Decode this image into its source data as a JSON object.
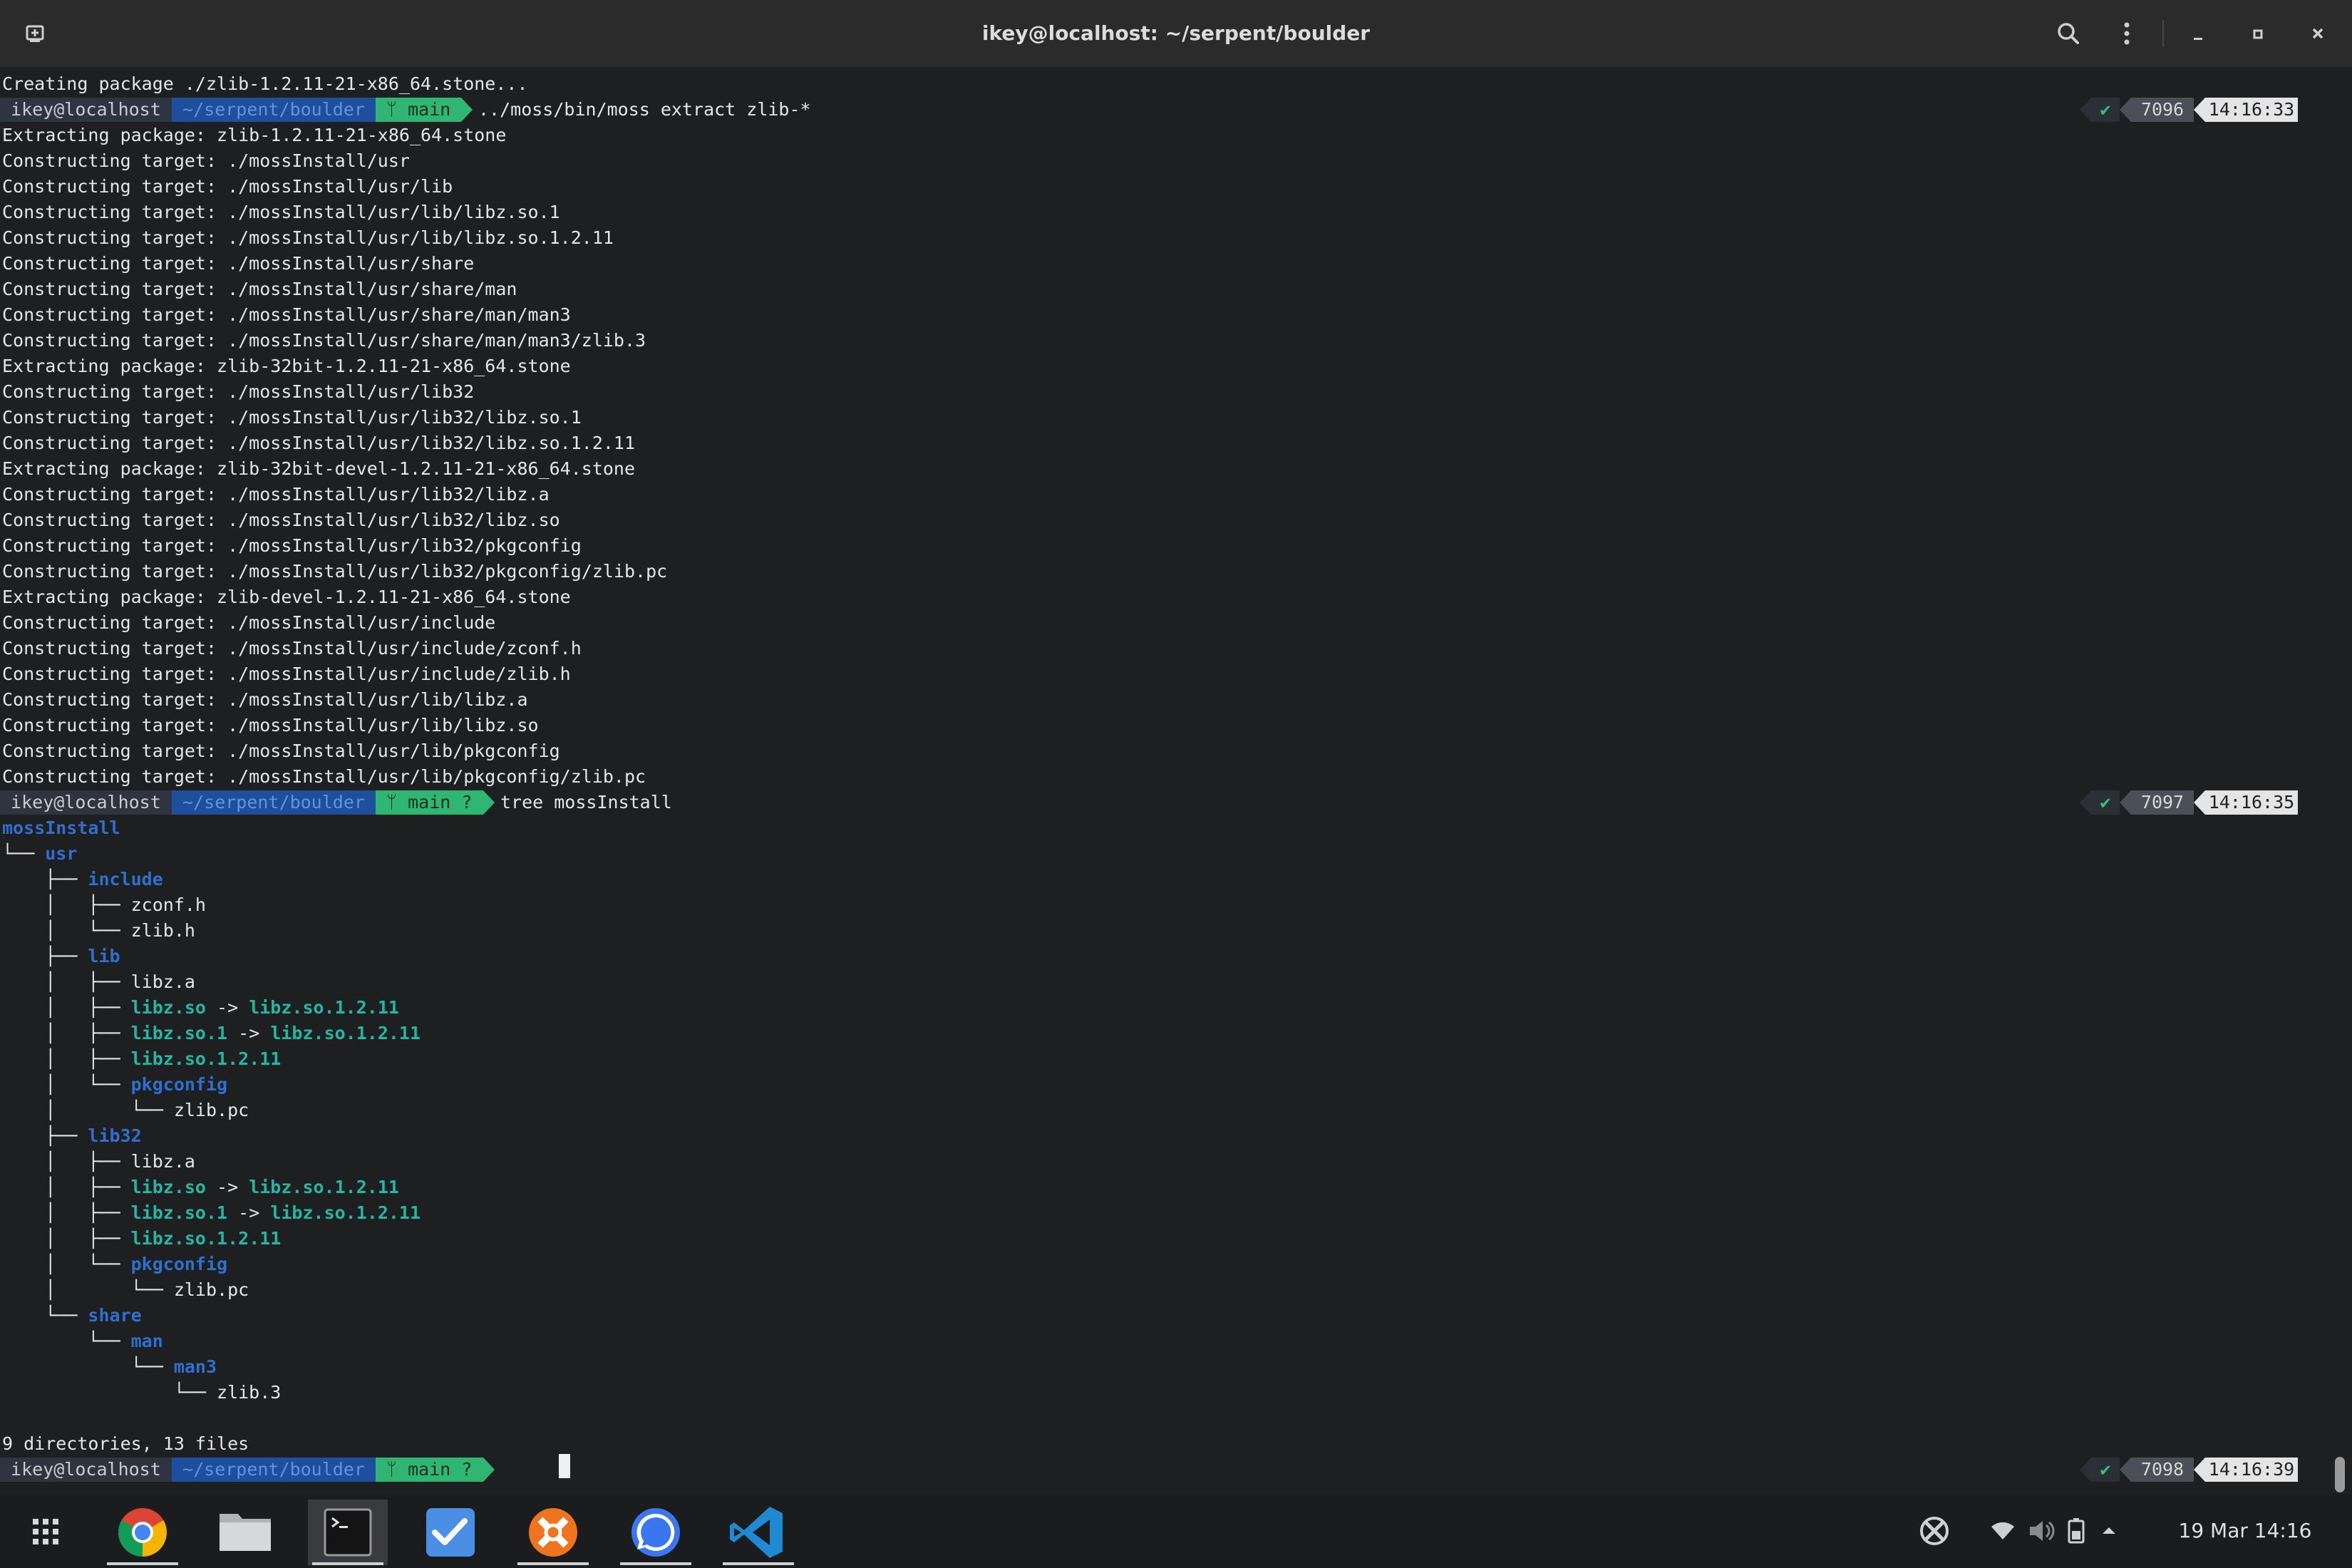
{
  "window": {
    "title": "ikey@localhost: ~/serpent/boulder"
  },
  "toolbar": {
    "new_tab_icon": "new-tab-icon",
    "search_icon": "search-icon",
    "menu_icon": "kebab-menu-icon",
    "minimize_icon": "minimize-icon",
    "maximize_icon": "maximize-icon",
    "close_icon": "close-icon"
  },
  "colors": {
    "background": "#1d1f21",
    "prompt_user_bg": "#2e3440",
    "prompt_path_bg": "#1d4f9c",
    "prompt_git_bg": "#2fb673",
    "directory": "#2f6fcf",
    "symlink": "#23b7a6"
  },
  "terminal": {
    "line1": "Creating package ./zlib-1.2.11-21-x86_64.stone...",
    "prompts": [
      {
        "user": " ikey@localhost ",
        "path": " ~/serpent/boulder ",
        "git": " ᛘ main ",
        "command": "../moss/bin/moss extract zlib-*",
        "status": "✔",
        "count": "7096",
        "time": "14:16:33"
      },
      {
        "user": " ikey@localhost ",
        "path": " ~/serpent/boulder ",
        "git": " ᛘ main ? ",
        "command": "tree mossInstall",
        "status": "✔",
        "count": "7097",
        "time": "14:16:35"
      },
      {
        "user": " ikey@localhost ",
        "path": " ~/serpent/boulder ",
        "git": " ᛘ main ? ",
        "command": "",
        "status": "✔",
        "count": "7098",
        "time": "14:16:39"
      }
    ],
    "extract_output": [
      "Extracting package: zlib-1.2.11-21-x86_64.stone",
      "Constructing target: ./mossInstall/usr",
      "Constructing target: ./mossInstall/usr/lib",
      "Constructing target: ./mossInstall/usr/lib/libz.so.1",
      "Constructing target: ./mossInstall/usr/lib/libz.so.1.2.11",
      "Constructing target: ./mossInstall/usr/share",
      "Constructing target: ./mossInstall/usr/share/man",
      "Constructing target: ./mossInstall/usr/share/man/man3",
      "Constructing target: ./mossInstall/usr/share/man/man3/zlib.3",
      "Extracting package: zlib-32bit-1.2.11-21-x86_64.stone",
      "Constructing target: ./mossInstall/usr/lib32",
      "Constructing target: ./mossInstall/usr/lib32/libz.so.1",
      "Constructing target: ./mossInstall/usr/lib32/libz.so.1.2.11",
      "Extracting package: zlib-32bit-devel-1.2.11-21-x86_64.stone",
      "Constructing target: ./mossInstall/usr/lib32/libz.a",
      "Constructing target: ./mossInstall/usr/lib32/libz.so",
      "Constructing target: ./mossInstall/usr/lib32/pkgconfig",
      "Constructing target: ./mossInstall/usr/lib32/pkgconfig/zlib.pc",
      "Extracting package: zlib-devel-1.2.11-21-x86_64.stone",
      "Constructing target: ./mossInstall/usr/include",
      "Constructing target: ./mossInstall/usr/include/zconf.h",
      "Constructing target: ./mossInstall/usr/include/zlib.h",
      "Constructing target: ./mossInstall/usr/lib/libz.a",
      "Constructing target: ./mossInstall/usr/lib/libz.so",
      "Constructing target: ./mossInstall/usr/lib/pkgconfig",
      "Constructing target: ./mossInstall/usr/lib/pkgconfig/zlib.pc"
    ],
    "tree_lines": [
      [
        {
          "t": "mossInstall",
          "c": "dir"
        }
      ],
      [
        {
          "t": "└── "
        },
        {
          "t": "usr",
          "c": "dir"
        }
      ],
      [
        {
          "t": "    ├── "
        },
        {
          "t": "include",
          "c": "dir"
        }
      ],
      [
        {
          "t": "    │   ├── zconf.h"
        }
      ],
      [
        {
          "t": "    │   └── zlib.h"
        }
      ],
      [
        {
          "t": "    ├── "
        },
        {
          "t": "lib",
          "c": "dir"
        }
      ],
      [
        {
          "t": "    │   ├── libz.a"
        }
      ],
      [
        {
          "t": "    │   ├── "
        },
        {
          "t": "libz.so",
          "c": "lnk"
        },
        {
          "t": " -> "
        },
        {
          "t": "libz.so.1.2.11",
          "c": "lnk"
        }
      ],
      [
        {
          "t": "    │   ├── "
        },
        {
          "t": "libz.so.1",
          "c": "lnk"
        },
        {
          "t": " -> "
        },
        {
          "t": "libz.so.1.2.11",
          "c": "lnk"
        }
      ],
      [
        {
          "t": "    │   ├── "
        },
        {
          "t": "libz.so.1.2.11",
          "c": "lnk"
        }
      ],
      [
        {
          "t": "    │   └── "
        },
        {
          "t": "pkgconfig",
          "c": "dir"
        }
      ],
      [
        {
          "t": "    │       └── zlib.pc"
        }
      ],
      [
        {
          "t": "    ├── "
        },
        {
          "t": "lib32",
          "c": "dir"
        }
      ],
      [
        {
          "t": "    │   ├── libz.a"
        }
      ],
      [
        {
          "t": "    │   ├── "
        },
        {
          "t": "libz.so",
          "c": "lnk"
        },
        {
          "t": " -> "
        },
        {
          "t": "libz.so.1.2.11",
          "c": "lnk"
        }
      ],
      [
        {
          "t": "    │   ├── "
        },
        {
          "t": "libz.so.1",
          "c": "lnk"
        },
        {
          "t": " -> "
        },
        {
          "t": "libz.so.1.2.11",
          "c": "lnk"
        }
      ],
      [
        {
          "t": "    │   ├── "
        },
        {
          "t": "libz.so.1.2.11",
          "c": "lnk"
        }
      ],
      [
        {
          "t": "    │   └── "
        },
        {
          "t": "pkgconfig",
          "c": "dir"
        }
      ],
      [
        {
          "t": "    │       └── zlib.pc"
        }
      ],
      [
        {
          "t": "    └── "
        },
        {
          "t": "share",
          "c": "dir"
        }
      ],
      [
        {
          "t": "        └── "
        },
        {
          "t": "man",
          "c": "dir"
        }
      ],
      [
        {
          "t": "            └── "
        },
        {
          "t": "man3",
          "c": "dir"
        }
      ],
      [
        {
          "t": "                └── zlib.3"
        }
      ],
      [
        {
          "t": ""
        }
      ]
    ],
    "summary": "9 directories, 13 files"
  },
  "taskbar": {
    "apps": [
      {
        "name": "app-grid-icon"
      },
      {
        "name": "chrome-icon"
      },
      {
        "name": "files-icon"
      },
      {
        "name": "terminal-icon"
      },
      {
        "name": "tasks-icon"
      },
      {
        "name": "ubuntu-cross-icon"
      },
      {
        "name": "signal-icon"
      },
      {
        "name": "vscode-icon"
      }
    ],
    "tray_icons": [
      "xbox-icon",
      "wifi-icon",
      "volume-icon",
      "battery-icon",
      "chevron-up-icon"
    ],
    "clock": "19 Mar  14:16"
  }
}
